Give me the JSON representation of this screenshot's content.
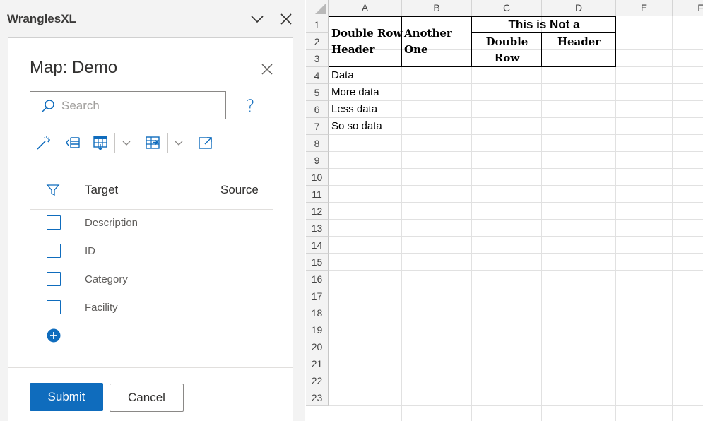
{
  "pane": {
    "title": "WranglesXL",
    "card_title": "Map: Demo",
    "search": {
      "placeholder": "Search",
      "value": ""
    },
    "help": "?",
    "columns": {
      "target": "Target",
      "source": "Source"
    },
    "rows": [
      {
        "label": "Description"
      },
      {
        "label": "ID"
      },
      {
        "label": "Category"
      },
      {
        "label": "Facility"
      }
    ],
    "submit_label": "Submit",
    "cancel_label": "Cancel"
  },
  "sheet": {
    "column_letters": [
      "A",
      "B",
      "C",
      "D",
      "E",
      "F"
    ],
    "row_numbers": [
      "1",
      "2",
      "3",
      "4",
      "5",
      "6",
      "7",
      "8",
      "9",
      "10",
      "11",
      "12",
      "13",
      "14",
      "15",
      "16",
      "17",
      "18",
      "19",
      "20",
      "21",
      "22",
      "23"
    ],
    "header_A": [
      "Double Row",
      "Header"
    ],
    "header_B": [
      "Another",
      "One"
    ],
    "header_CD_merged": "This is Not a",
    "header_C": [
      "Double",
      "Row"
    ],
    "header_D": "Header",
    "data_A": [
      "Data",
      "More data",
      "Less data",
      "So so data"
    ]
  },
  "colors": {
    "accent": "#0f6cbd"
  }
}
